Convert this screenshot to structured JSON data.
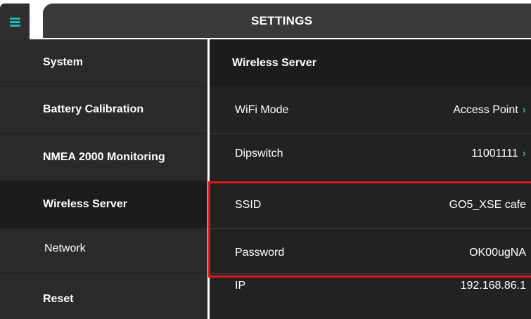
{
  "app": {
    "title": "SETTINGS"
  },
  "icons": {
    "menu": "hamburger-menu-icon",
    "chevron": "chevron-right-icon"
  },
  "colors": {
    "accent": "#1fb7b0",
    "highlight": "#e0141d"
  },
  "sidebar": {
    "items": [
      {
        "label": "System"
      },
      {
        "label": "Battery Calibration"
      },
      {
        "label": "NMEA 2000 Monitoring"
      },
      {
        "label": "Wireless Server",
        "active": true
      },
      {
        "label": "Network"
      },
      {
        "label": "Reset"
      }
    ]
  },
  "main": {
    "section_title": "Wireless Server",
    "rows": [
      {
        "label": "WiFi Mode",
        "value": "Access Point",
        "chevron": "›"
      },
      {
        "label": "Dipswitch",
        "value": "11001111",
        "chevron": "›"
      },
      {
        "label": "SSID",
        "value": "GO5_XSE cafe"
      },
      {
        "label": "Password",
        "value": "OK00ugNA"
      },
      {
        "label": "IP",
        "value": "192.168.86.1"
      }
    ]
  }
}
